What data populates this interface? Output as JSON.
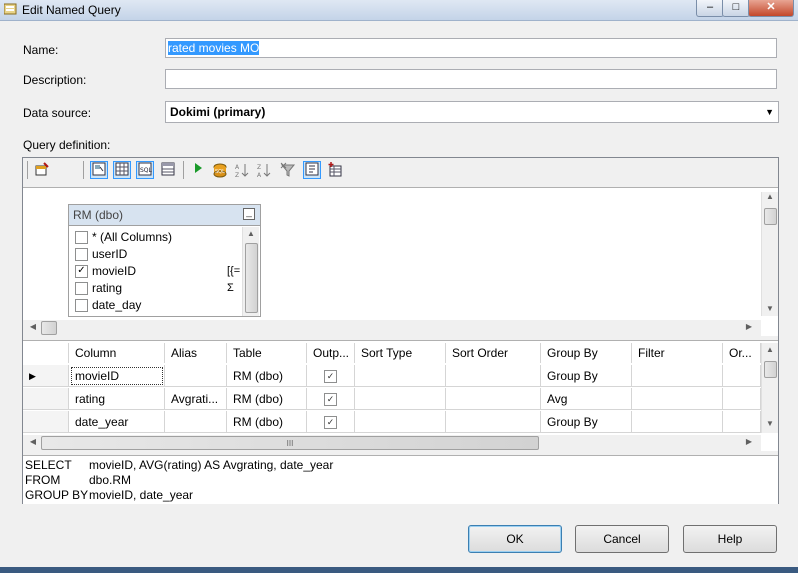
{
  "window": {
    "title": "Edit Named Query",
    "buttons": {
      "minimize": "‒",
      "maximize": "□",
      "close": "✕"
    }
  },
  "form": {
    "name_label": "Name:",
    "name_value": "rated movies MO",
    "description_label": "Description:",
    "description_value": "",
    "datasource_label": "Data source:",
    "datasource_value": "Dokimi (primary)",
    "query_label": "Query definition:"
  },
  "diagram": {
    "table_title": "RM (dbo)",
    "columns": [
      {
        "label": "* (All Columns)",
        "checked": false,
        "marker": ""
      },
      {
        "label": "userID",
        "checked": false,
        "marker": ""
      },
      {
        "label": "movieID",
        "checked": true,
        "marker": "[{="
      },
      {
        "label": "rating",
        "checked": false,
        "marker": "Σ"
      },
      {
        "label": "date_day",
        "checked": false,
        "marker": ""
      }
    ]
  },
  "grid": {
    "headers": [
      "Column",
      "Alias",
      "Table",
      "Outp...",
      "Sort Type",
      "Sort Order",
      "Group By",
      "Filter",
      "Or..."
    ],
    "rows": [
      {
        "column": "movieID",
        "alias": "",
        "table": "RM (dbo)",
        "output": true,
        "group_by": "Group By",
        "current": true
      },
      {
        "column": "rating",
        "alias": "Avgrati...",
        "table": "RM (dbo)",
        "output": true,
        "group_by": "Avg",
        "current": false
      },
      {
        "column": "date_year",
        "alias": "",
        "table": "RM (dbo)",
        "output": true,
        "group_by": "Group By",
        "current": false
      }
    ],
    "hscroll_grip": "III"
  },
  "sql": {
    "lines": [
      {
        "keyword": "SELECT",
        "text": "movieID, AVG(rating) AS Avgrating, date_year"
      },
      {
        "keyword": "FROM",
        "text": "dbo.RM"
      },
      {
        "keyword": "GROUP BY",
        "text": "movieID, date_year"
      }
    ]
  },
  "buttons": {
    "ok": "OK",
    "cancel": "Cancel",
    "help": "Help"
  },
  "icons": [
    "app-icon",
    "add-table-icon",
    "diagram-pane-icon",
    "grid-pane-icon",
    "sql-pane-icon",
    "results-pane-icon",
    "run-query-icon",
    "verify-sql-icon",
    "sort-ascending-icon",
    "sort-descending-icon",
    "remove-filter-icon",
    "add-group-by-icon",
    "add-table-grid-icon"
  ]
}
